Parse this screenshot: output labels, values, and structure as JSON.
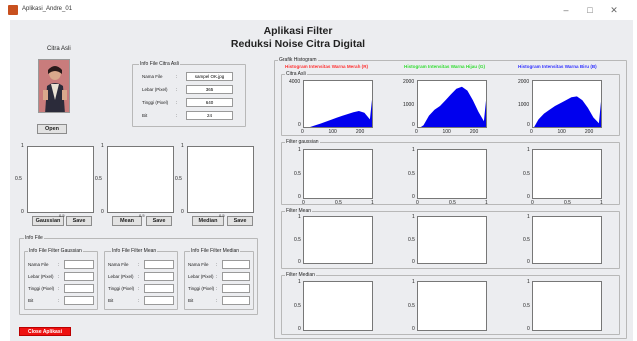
{
  "window": {
    "title": "Aplikasi_Andre_01",
    "minimize": "–",
    "maximize": "□",
    "close": "✕"
  },
  "header": {
    "title_line1": "Aplikasi Filter",
    "title_line2": "Reduksi Noise Citra Digital"
  },
  "citra_asli": {
    "label": "Citra Asli",
    "open_button": "Open"
  },
  "info_file_citra_asli": {
    "title": "Info File Citra Asli",
    "fields": [
      {
        "label": "Nama File",
        "sep": ":",
        "value": "sampel OK.jpg"
      },
      {
        "label": "Lebar (Pixel)",
        "sep": ":",
        "value": "365"
      },
      {
        "label": "Tinggi (Pixel)",
        "sep": ":",
        "value": "640"
      },
      {
        "label": "Bit",
        "sep": ":",
        "value": "24"
      }
    ]
  },
  "filter_axes": {
    "y_ticks": [
      "1",
      "0.5",
      "0"
    ],
    "x_ticks": [
      "0",
      "0.5",
      "1"
    ],
    "buttons": [
      {
        "label": "Gaussian",
        "save": "Save"
      },
      {
        "label": "Mean",
        "save": "Save"
      },
      {
        "label": "Median",
        "save": "Save"
      }
    ]
  },
  "info_file": {
    "title": "Info File",
    "groups": [
      {
        "title": "Info File Filter Gaussian",
        "fields": [
          "Nama File",
          "Lebar (Pixel)",
          "Tinggi (Pixel)",
          "Bit"
        ],
        "sep": ":"
      },
      {
        "title": "Info File Filter Mean",
        "fields": [
          "Nama File",
          "Lebar (Pixel)",
          "Tinggi (Pixel)",
          "Bit"
        ],
        "sep": ":"
      },
      {
        "title": "Info File Filter Median",
        "fields": [
          "Nama File",
          "Lebar (Pixel)",
          "Tinggi (Pixel)",
          "Bit"
        ],
        "sep": ":"
      }
    ]
  },
  "close_button": "Close Aplikasi",
  "grafik": {
    "title": "Grafik Histogram",
    "headers": [
      {
        "text": "Histogram Intensitas Warna Merah (R)",
        "color": "#ff3333"
      },
      {
        "text": "Histogram Intensitas Warna Hijau (G)",
        "color": "#33dd33"
      },
      {
        "text": "Histogram Intensitas Warna Biru (B)",
        "color": "#3333ff"
      }
    ],
    "panels": [
      {
        "title": "Citra Asli"
      },
      {
        "title": "Filter gaussian"
      },
      {
        "title": "Filter Mean"
      },
      {
        "title": "Filter Median"
      }
    ],
    "hist_color": "#0000ee"
  },
  "chart_data": [
    {
      "type": "area",
      "name": "R",
      "x": [
        0,
        20,
        40,
        60,
        80,
        100,
        120,
        140,
        160,
        180,
        200,
        220,
        240,
        255
      ],
      "values": [
        0,
        150,
        300,
        450,
        620,
        780,
        950,
        1100,
        1250,
        1400,
        1500,
        1350,
        800,
        4000
      ],
      "ylim": [
        0,
        4000
      ],
      "yticks": [
        "4000",
        "2000",
        "0"
      ],
      "xticks": [
        "0",
        "100",
        "200"
      ]
    },
    {
      "type": "area",
      "name": "G",
      "x": [
        0,
        20,
        40,
        60,
        80,
        100,
        120,
        140,
        160,
        180,
        200,
        220,
        240,
        255
      ],
      "values": [
        0,
        200,
        700,
        1000,
        1200,
        1500,
        1800,
        2100,
        2200,
        2000,
        1500,
        900,
        400,
        2600
      ],
      "ylim": [
        0,
        2500
      ],
      "yticks": [
        "2000",
        "1000",
        "0"
      ],
      "xticks": [
        "0",
        "100",
        "200"
      ]
    },
    {
      "type": "area",
      "name": "B",
      "x": [
        0,
        20,
        40,
        60,
        80,
        100,
        120,
        140,
        160,
        180,
        200,
        220,
        240,
        255
      ],
      "values": [
        0,
        500,
        800,
        1000,
        1200,
        1350,
        1500,
        1650,
        1700,
        1500,
        1100,
        600,
        300,
        2600
      ],
      "ylim": [
        0,
        2500
      ],
      "yticks": [
        "2000",
        "1000",
        "0"
      ],
      "xticks": [
        "0",
        "100",
        "200"
      ]
    }
  ]
}
